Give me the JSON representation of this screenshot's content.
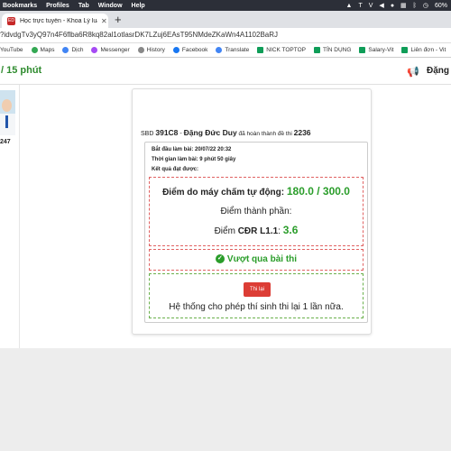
{
  "menubar": {
    "items": [
      "Bookmarks",
      "Profiles",
      "Tab",
      "Window",
      "Help"
    ],
    "battery": "60%"
  },
  "browser": {
    "tab_title": "Học trực tuyến - Khoa Lý luận",
    "url": "?idvdgTv3yQ97n4F6flba6R8kq82al1otlasrDK7LZuj6EAsT95NMdeZKaWn4A1102BaRJ",
    "bookmarks": [
      "YouTube",
      "Maps",
      "Dịch",
      "Messenger",
      "History",
      "Facebook",
      "Translate",
      "NICK TOPTOP",
      "TÍN DỤNG",
      "Salary-Vit",
      "Liên đơn - Vit"
    ]
  },
  "header": {
    "timer": "/ 15 phút",
    "user_name": "Đặng Đ"
  },
  "sidebar": {
    "student_id": "247"
  },
  "result": {
    "sbd_label": "SBD",
    "sbd": "391C8",
    "sep": " - ",
    "name": "Đặng Đức Duy",
    "completed_text": " đã hoàn thành đề thi ",
    "exam_id": "2236",
    "start_time": "Bắt đầu làm bài: 20/07/22 20:32",
    "duration": "Thời gian làm bài: 9 phút 50 giây",
    "results_label": "Kết quả đạt được:",
    "auto_score_label": "Điểm do máy chấm tự động: ",
    "auto_score": "180.0 / 300.0",
    "component_label": "Điểm thành phần:",
    "cdr_label_prefix": "Điểm ",
    "cdr_label": "CĐR L1.1",
    "cdr_colon": ": ",
    "cdr_score": "3.6",
    "pass_text": "Vượt qua bài thi",
    "retry_button": "Thi lại",
    "retry_message": "Hệ thống cho phép thí sinh thi lại 1 lần nữa."
  },
  "colors": {
    "success": "#2a9d2a",
    "danger": "#dc3d35",
    "timer": "#2e8b2e"
  }
}
